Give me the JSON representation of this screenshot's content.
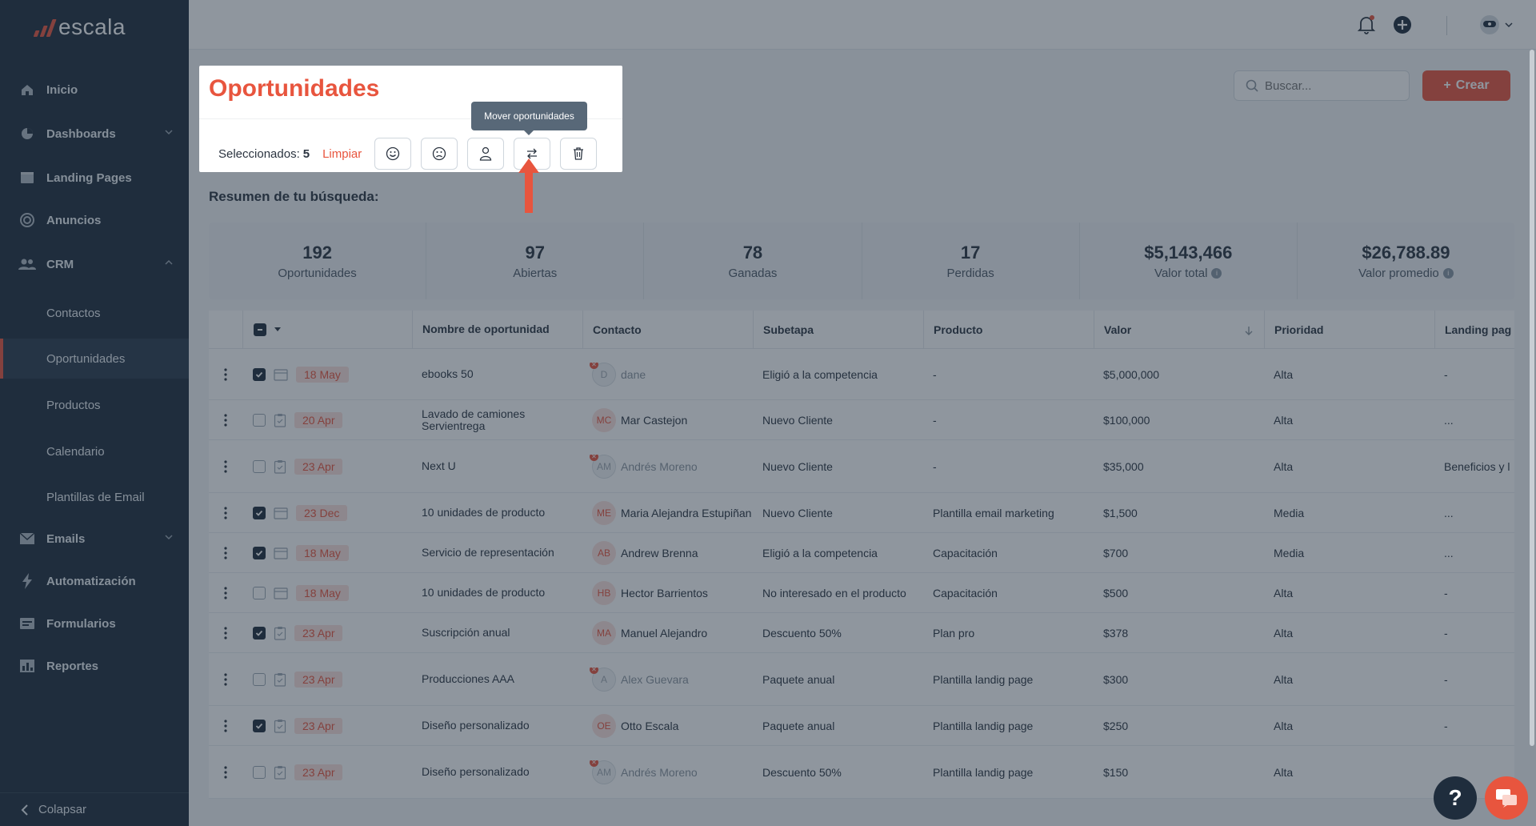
{
  "brand": {
    "name": "escala",
    "accent": "#e8553e",
    "sidebar_bg": "#1f2d3d"
  },
  "sidebar": {
    "items": [
      {
        "label": "Inicio",
        "icon": "home-icon"
      },
      {
        "label": "Dashboards",
        "icon": "pie-chart-icon"
      },
      {
        "label": "Landing Pages",
        "icon": "layout-icon"
      },
      {
        "label": "Anuncios",
        "icon": "target-icon"
      },
      {
        "label": "CRM",
        "icon": "users-icon"
      },
      {
        "label": "Emails",
        "icon": "mail-icon"
      },
      {
        "label": "Automatización",
        "icon": "lightning-icon"
      },
      {
        "label": "Formularios",
        "icon": "form-icon"
      },
      {
        "label": "Reportes",
        "icon": "chart-icon"
      }
    ],
    "crm_sub": [
      "Contactos",
      "Oportunidades",
      "Productos",
      "Calendario",
      "Plantillas de Email"
    ],
    "active_sub": "Oportunidades",
    "collapse_label": "Colapsar"
  },
  "header": {
    "title": "Oportunidades",
    "search_placeholder": "Buscar...",
    "create_label": "Crear"
  },
  "selection": {
    "label": "Seleccionados:",
    "count": "5",
    "clear_label": "Limpiar",
    "tooltip": "Mover oportunidades"
  },
  "summary": {
    "title": "Resumen de tu búsqueda:",
    "stats": [
      {
        "value": "192",
        "label": "Oportunidades"
      },
      {
        "value": "97",
        "label": "Abiertas"
      },
      {
        "value": "78",
        "label": "Ganadas"
      },
      {
        "value": "17",
        "label": "Perdidas"
      },
      {
        "value": "$5,143,466",
        "label": "Valor total"
      },
      {
        "value": "$26,788.89",
        "label": "Valor promedio"
      }
    ]
  },
  "table": {
    "columns": [
      "Nombre de oportunidad",
      "Contacto",
      "Subetapa",
      "Producto",
      "Valor",
      "Prioridad",
      "Landing pag"
    ],
    "rows": [
      {
        "checked": true,
        "date": "18 May",
        "name": "ebooks 50",
        "initials": "D",
        "contact": "dane",
        "inactive": true,
        "substage": "Eligió a la competencia",
        "product": "-",
        "value": "$5,000,000",
        "priority": "Alta",
        "landing": "-"
      },
      {
        "checked": false,
        "date": "20 Apr",
        "name": "Lavado de camiones Servientrega",
        "initials": "MC",
        "contact": "Mar Castejon",
        "inactive": false,
        "substage": "Nuevo Cliente",
        "product": "-",
        "value": "$100,000",
        "priority": "Alta",
        "landing": "..."
      },
      {
        "checked": false,
        "date": "23 Apr",
        "name": "Next U",
        "initials": "AM",
        "contact": "Andrés Moreno",
        "inactive": true,
        "substage": "Nuevo Cliente",
        "product": "-",
        "value": "$35,000",
        "priority": "Alta",
        "landing": "Beneficios y l"
      },
      {
        "checked": true,
        "date": "23 Dec",
        "name": "10 unidades de producto",
        "initials": "ME",
        "contact": "Maria Alejandra Estupiñan",
        "inactive": false,
        "substage": "Nuevo Cliente",
        "product": "Plantilla email marketing",
        "value": "$1,500",
        "priority": "Media",
        "landing": "..."
      },
      {
        "checked": true,
        "date": "18 May",
        "name": "Servicio de representación",
        "initials": "AB",
        "contact": "Andrew Brenna",
        "inactive": false,
        "substage": "Eligió a la competencia",
        "product": "Capacitación",
        "value": "$700",
        "priority": "Media",
        "landing": "..."
      },
      {
        "checked": false,
        "date": "18 May",
        "name": "10 unidades de producto",
        "initials": "HB",
        "contact": "Hector Barrientos",
        "inactive": false,
        "substage": "No interesado en el producto",
        "product": "Capacitación",
        "value": "$500",
        "priority": "Alta",
        "landing": "-"
      },
      {
        "checked": true,
        "date": "23 Apr",
        "name": "Suscripción anual",
        "initials": "MA",
        "contact": "Manuel Alejandro",
        "inactive": false,
        "substage": "Descuento 50%",
        "product": "Plan pro",
        "value": "$378",
        "priority": "Alta",
        "landing": "-"
      },
      {
        "checked": false,
        "date": "23 Apr",
        "name": "Producciones AAA",
        "initials": "A",
        "contact": "Alex Guevara",
        "inactive": true,
        "substage": "Paquete anual",
        "product": "Plantilla landig page",
        "value": "$300",
        "priority": "Alta",
        "landing": "-"
      },
      {
        "checked": true,
        "date": "23 Apr",
        "name": "Diseño personalizado",
        "initials": "OE",
        "contact": "Otto Escala",
        "inactive": false,
        "substage": "Paquete anual",
        "product": "Plantilla landig page",
        "value": "$250",
        "priority": "Alta",
        "landing": "-"
      },
      {
        "checked": false,
        "date": "23 Apr",
        "name": "Diseño personalizado",
        "initials": "AM",
        "contact": "Andrés Moreno",
        "inactive": true,
        "substage": "Descuento 50%",
        "product": "Plantilla landig page",
        "value": "$150",
        "priority": "Alta",
        "landing": ""
      }
    ]
  },
  "help_label": "?"
}
